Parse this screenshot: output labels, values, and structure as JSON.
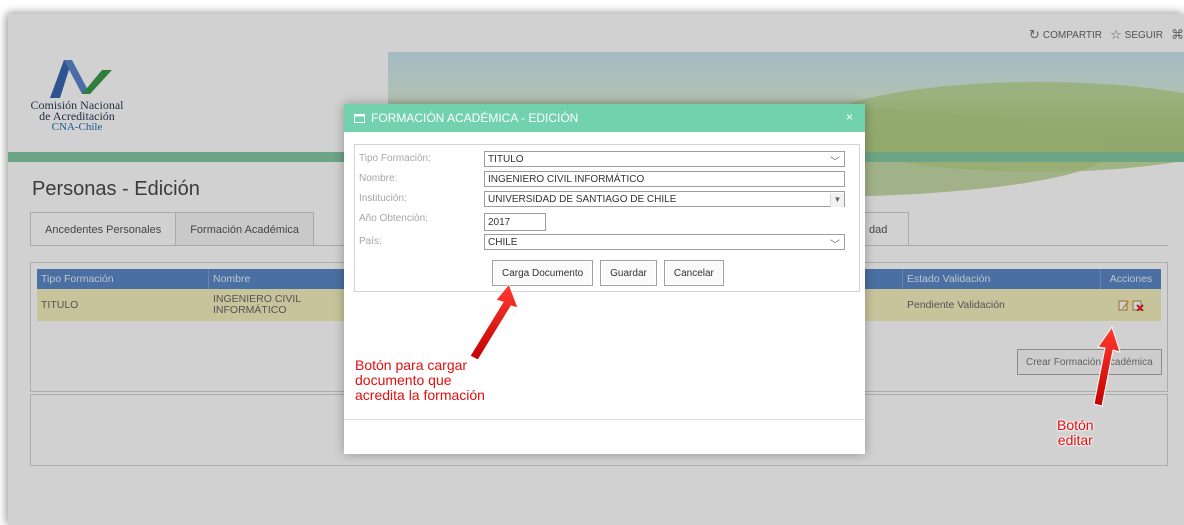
{
  "topbar": {
    "share_label": "COMPARTIR",
    "follow_label": "SEGUIR"
  },
  "logo": {
    "line1": "Comisión Nacional",
    "line2": "de Acreditación",
    "line3": "CNA-Chile"
  },
  "page": {
    "title": "Personas - Edición"
  },
  "tabs": [
    {
      "label": "Ancedentes Personales"
    },
    {
      "label": "Formación Académica"
    },
    {
      "label": "dad"
    }
  ],
  "grid": {
    "columns": [
      "Tipo Formación",
      "Nombre",
      "Estado Validación",
      "Acciones"
    ],
    "rows": [
      {
        "tipo": "TITULO",
        "nombre": "INGENIERO CIVIL INFORMÁTICO",
        "estado": "Pendiente Validación"
      }
    ],
    "create_button": "Crear Formación Académica"
  },
  "modal": {
    "title": "FORMACIÓN ACADÉMICA - EDICIÓN",
    "close": "×",
    "fields": {
      "tipo_label": "Tipo Formación:",
      "tipo_value": "TITULO",
      "nombre_label": "Nombre:",
      "nombre_value": "INGENIERO CIVIL INFORMÁTICO",
      "institucion_label": "Institución:",
      "institucion_value": "UNIVERSIDAD DE SANTIAGO DE CHILE",
      "anio_label": "Año Obtención:",
      "anio_value": "2017",
      "pais_label": "País:",
      "pais_value": "CHILE"
    },
    "buttons": {
      "upload": "Carga Documento",
      "save": "Guardar",
      "cancel": "Cancelar"
    }
  },
  "annotations": {
    "upload_note_1": "Botón para cargar",
    "upload_note_2": "documento que",
    "upload_note_3": "acredita la formación",
    "edit_note_1": "Botón",
    "edit_note_2": "editar"
  },
  "colors": {
    "modal_header": "#72d2ad",
    "grid_header": "#5b88c6",
    "row_highlight": "#f3efbf",
    "annotation": "#e30e0e"
  }
}
